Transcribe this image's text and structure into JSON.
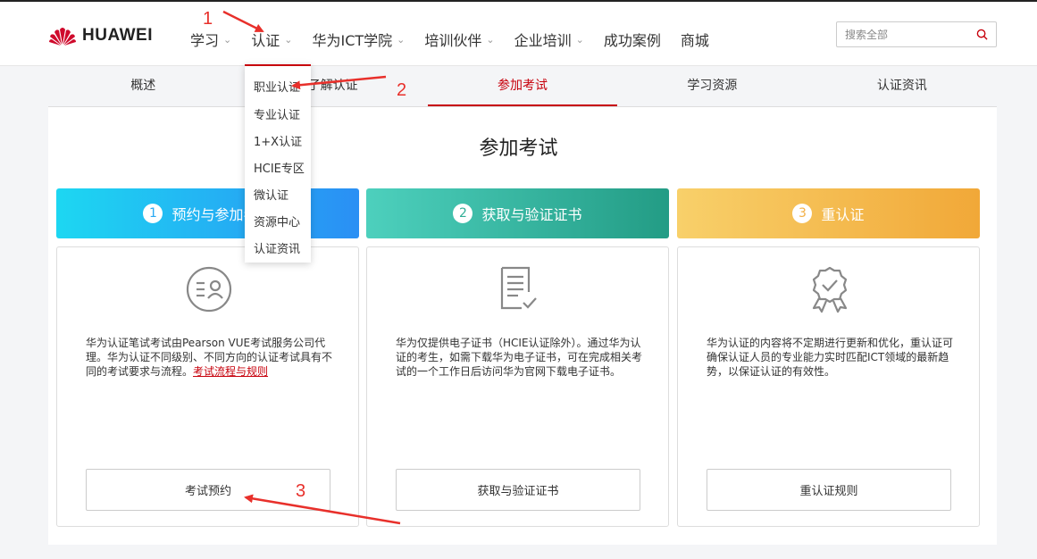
{
  "header": {
    "brand": "HUAWEI",
    "nav": [
      {
        "label": "学习",
        "has_dropdown": true
      },
      {
        "label": "认证",
        "has_dropdown": true
      },
      {
        "label": "华为ICT学院",
        "has_dropdown": true
      },
      {
        "label": "培训伙伴",
        "has_dropdown": true
      },
      {
        "label": "企业培训",
        "has_dropdown": true
      },
      {
        "label": "成功案例",
        "has_dropdown": false
      },
      {
        "label": "商城",
        "has_dropdown": false
      }
    ],
    "search_placeholder": "搜索全部"
  },
  "tabs": [
    {
      "label": "概述"
    },
    {
      "label": "了解认证"
    },
    {
      "label": "参加考试",
      "active": true
    },
    {
      "label": "学习资源"
    },
    {
      "label": "认证资讯"
    }
  ],
  "dropdown": {
    "items": [
      "职业认证",
      "专业认证",
      "1+X认证",
      "HCIE专区",
      "微认证",
      "资源中心",
      "认证资讯"
    ]
  },
  "page_title": "参加考试",
  "steps": [
    {
      "num": "1",
      "title": "预约与参加考试"
    },
    {
      "num": "2",
      "title": "获取与验证证书"
    },
    {
      "num": "3",
      "title": "重认证"
    }
  ],
  "cards": [
    {
      "icon": "id-card-icon",
      "text": "华为认证笔试考试由Pearson VUE考试服务公司代理。华为认证不同级别、不同方向的认证考试具有不同的考试要求与流程。",
      "link": "考试流程与规则",
      "button": "考试预约"
    },
    {
      "icon": "certificate-document-icon",
      "text": "华为仅提供电子证书（HCIE认证除外）。通过华为认证的考生，如需下载华为电子证书，可在完成相关考试的一个工作日后访问华为官网下载电子证书。",
      "button": "获取与验证证书"
    },
    {
      "icon": "award-badge-icon",
      "text": "华为认证的内容将不定期进行更新和优化，重认证可确保认证人员的专业能力实时匹配ICT领域的最新趋势，以保证认证的有效性。",
      "button": "重认证规则"
    }
  ],
  "annotations": [
    "1",
    "2",
    "3"
  ],
  "colors": {
    "brand_red": "#c7000b",
    "annotation_red": "#e8302b"
  }
}
